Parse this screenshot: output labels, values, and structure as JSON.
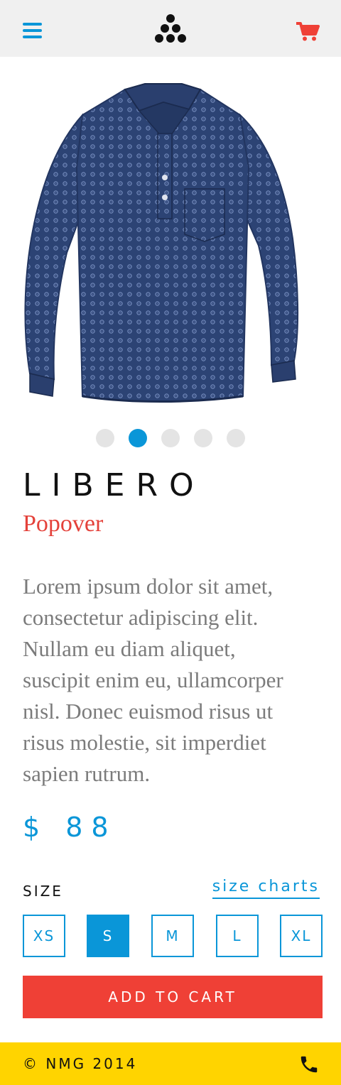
{
  "header": {
    "menu_icon": "hamburger-menu-icon",
    "logo_icon": "triangle-dots-logo-icon",
    "cart_icon": "shopping-cart-icon"
  },
  "gallery": {
    "image_description": "navy polka-dot long-sleeve popover shirt",
    "total_slides": 5,
    "active_slide": 2
  },
  "product": {
    "name": "LIBERO",
    "subtitle": "Popover",
    "description": "Lorem ipsum dolor sit amet, consectetur adipiscing elit. Nullam eu diam aliquet, suscipit enim eu, ullamcorper nisl. Donec euismod risus ut risus molestie, sit imperdiet sapien rutrum.",
    "price": "$ 88"
  },
  "size": {
    "label": "SIZE",
    "chart_link": "size charts",
    "options": [
      "XS",
      "S",
      "M",
      "L",
      "XL"
    ],
    "selected": "S"
  },
  "actions": {
    "add_to_cart": "ADD TO CART"
  },
  "footer": {
    "copyright": "© NMG 2014",
    "phone_icon": "phone-icon"
  },
  "colors": {
    "accent_blue": "#0a96d8",
    "accent_red": "#ef4036",
    "footer_yellow": "#ffd400",
    "header_gray": "#f0f0f0",
    "text_gray": "#7b7b7b"
  }
}
